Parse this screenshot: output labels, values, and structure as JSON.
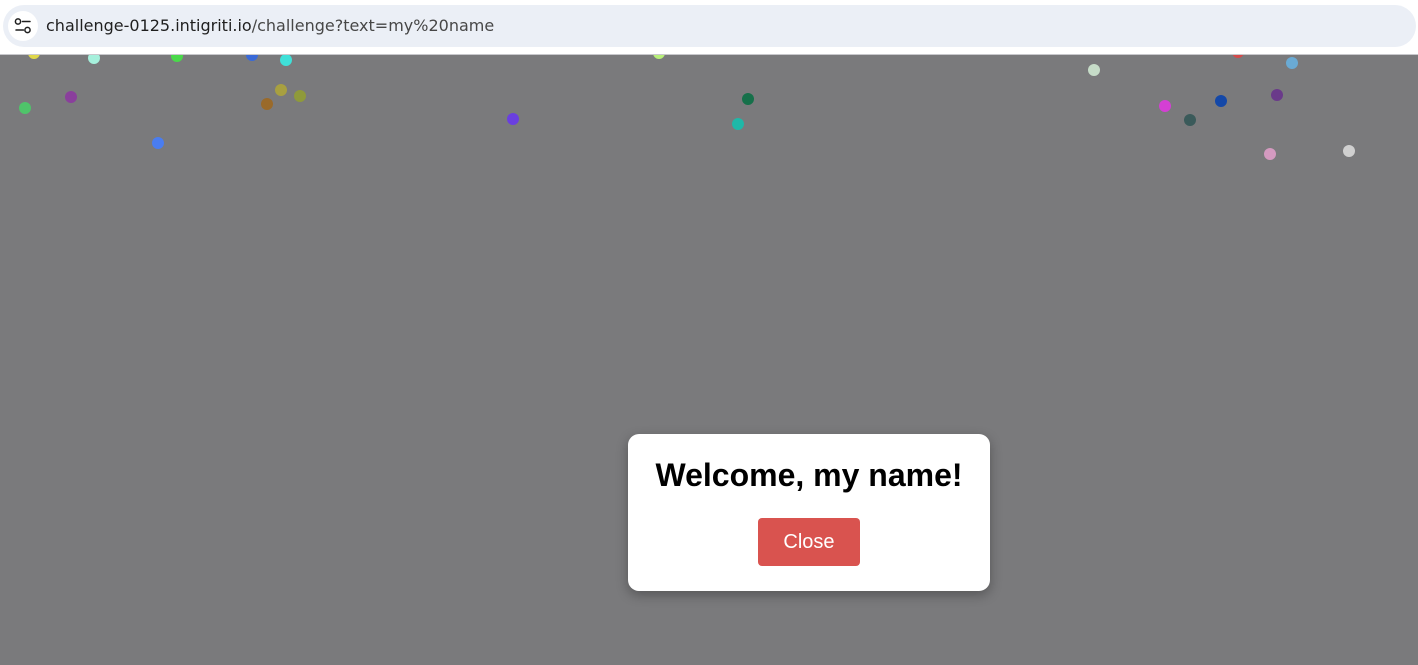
{
  "browser": {
    "url_host": "challenge-0125.intigriti.io",
    "url_path": "/challenge?text=my%20name",
    "site_info_icon": "tune-icon"
  },
  "page": {
    "background_color": "#7a7a7c"
  },
  "modal": {
    "title": "Welcome, my name!",
    "close_label": "Close",
    "close_color": "#d9534f"
  }
}
